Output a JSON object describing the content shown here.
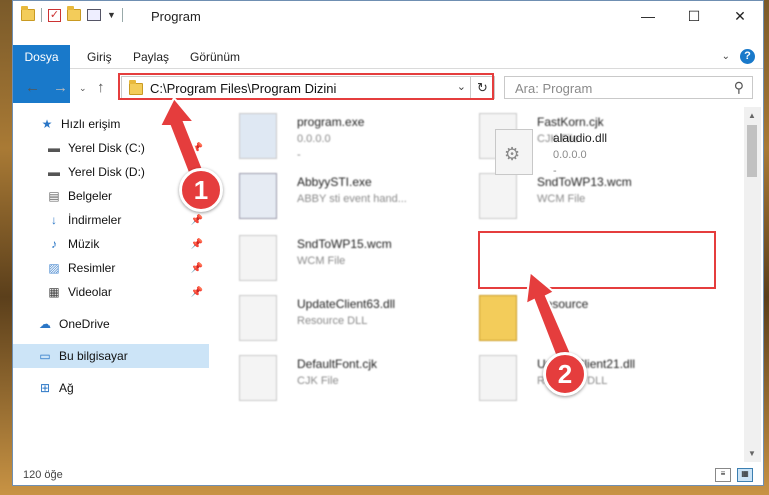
{
  "window": {
    "title": "Program",
    "minimize": "—",
    "maximize": "☐",
    "close": "✕"
  },
  "ribbon": {
    "tabs": [
      "Dosya",
      "Giriş",
      "Paylaş",
      "Görünüm"
    ]
  },
  "address": {
    "path": "C:\\Program Files\\Program Dizini"
  },
  "search": {
    "placeholder": "Ara: Program"
  },
  "sidebar": {
    "items": [
      {
        "label": "Hızlı erişim",
        "icon": "star-icon"
      },
      {
        "label": "Yerel Disk (C:)",
        "icon": "drive-icon"
      },
      {
        "label": "Yerel Disk (D:)",
        "icon": "drive-icon"
      },
      {
        "label": "Belgeler",
        "icon": "documents-icon"
      },
      {
        "label": "İndirmeler",
        "icon": "download-icon"
      },
      {
        "label": "Müzik",
        "icon": "music-icon"
      },
      {
        "label": "Resimler",
        "icon": "pictures-icon"
      },
      {
        "label": "Videolar",
        "icon": "video-icon"
      },
      {
        "label": "OneDrive",
        "icon": "cloud-icon"
      },
      {
        "label": "Bu bilgisayar",
        "icon": "computer-icon"
      },
      {
        "label": "Ağ",
        "icon": "network-icon"
      }
    ]
  },
  "files": [
    {
      "name": "program.exe",
      "sub": "0.0.0.0",
      "sub2": "-"
    },
    {
      "name": "FastKorn.cjk",
      "sub": "CJK File",
      "sub2": ""
    },
    {
      "name": "AbbyySTI.exe",
      "sub": "ABBY sti event hand...",
      "sub2": ""
    },
    {
      "name": "SndToWP13.wcm",
      "sub": "WCM File",
      "sub2": ""
    },
    {
      "name": "SndToWP15.wcm",
      "sub": "WCM File",
      "sub2": ""
    },
    {
      "name": "alaudio.dll",
      "sub": "0.0.0.0",
      "sub2": "-"
    },
    {
      "name": "UpdateClient63.dll",
      "sub": "Resource DLL",
      "sub2": ""
    },
    {
      "name": "Resource",
      "sub": "",
      "sub2": ""
    },
    {
      "name": "DefaultFont.cjk",
      "sub": "CJK File",
      "sub2": ""
    },
    {
      "name": "UpdateClient21.dll",
      "sub": "Resource DLL",
      "sub2": ""
    }
  ],
  "status": {
    "count": "120 öğe"
  },
  "annotations": {
    "badge1": "1",
    "badge2": "2",
    "color": "#e53d3d"
  }
}
